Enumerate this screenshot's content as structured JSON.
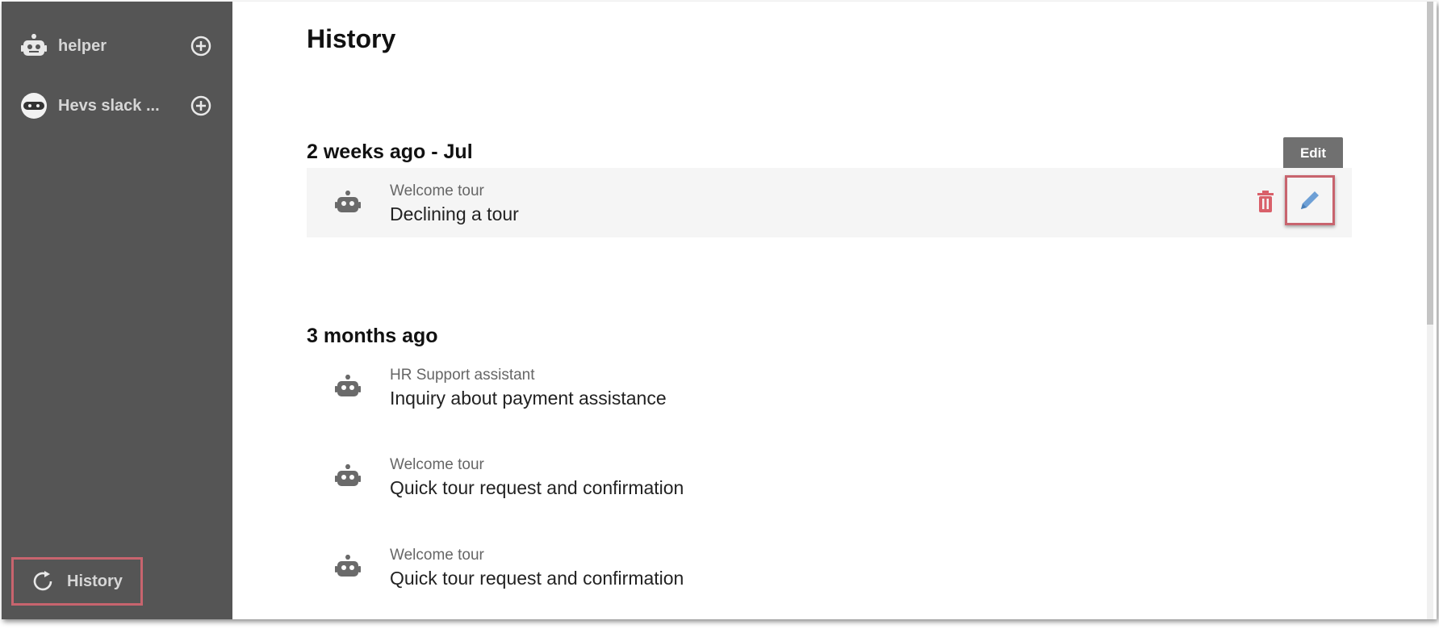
{
  "sidebar": {
    "bots": [
      {
        "name": "helper",
        "icon": "robot-icon"
      },
      {
        "name": "Hevs slack ...",
        "icon": "ninja-icon"
      }
    ],
    "history_label": "History"
  },
  "main": {
    "title": "History",
    "tooltip": "Edit",
    "groups": [
      {
        "title": "2 weeks ago - Jul",
        "items": [
          {
            "subtitle": "Welcome tour",
            "label": "Declining a tour"
          }
        ]
      },
      {
        "title": "3 months ago",
        "items": [
          {
            "subtitle": "HR Support assistant",
            "label": "Inquiry about payment assistance"
          },
          {
            "subtitle": "Welcome tour",
            "label": "Quick tour request and confirmation"
          },
          {
            "subtitle": "Welcome tour",
            "label": "Quick tour request and confirmation"
          }
        ]
      }
    ]
  },
  "colors": {
    "sidebar_bg": "#555555",
    "highlight_border": "#c8646e",
    "delete_icon": "#d9606a",
    "edit_icon": "#6ea0d6",
    "tooltip_bg": "#707070"
  }
}
